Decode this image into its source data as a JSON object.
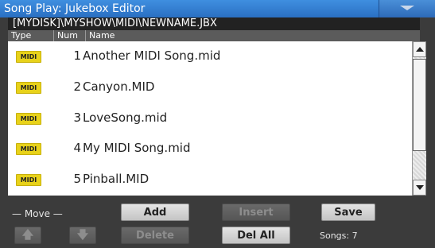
{
  "window": {
    "title": "Song Play: Jukebox Editor"
  },
  "path": "[MYDISK]\\MYSHOW\\MIDI\\NEWNAME.JBX",
  "columns": {
    "type": "Type",
    "num": "Num",
    "name": "Name"
  },
  "songs": [
    {
      "type": "MIDI",
      "num": "1",
      "name": "Another MIDI Song.mid"
    },
    {
      "type": "MIDI",
      "num": "2",
      "name": "Canyon.MID"
    },
    {
      "type": "MIDI",
      "num": "3",
      "name": "LoveSong.mid"
    },
    {
      "type": "MIDI",
      "num": "4",
      "name": "My MIDI Song.mid"
    },
    {
      "type": "MIDI",
      "num": "5",
      "name": "Pinball.MID"
    }
  ],
  "controls": {
    "move_label": "— Move —",
    "up_icon": "up-arrow-icon",
    "down_icon": "down-arrow-icon",
    "add": "Add",
    "insert": "Insert",
    "save": "Save",
    "delete": "Delete",
    "del_all": "Del All",
    "songs_count": "Songs: 7"
  },
  "colors": {
    "title_bar": "#2f7fd6",
    "midi_badge": "#e8d21a",
    "background": "#3b3b3b"
  }
}
